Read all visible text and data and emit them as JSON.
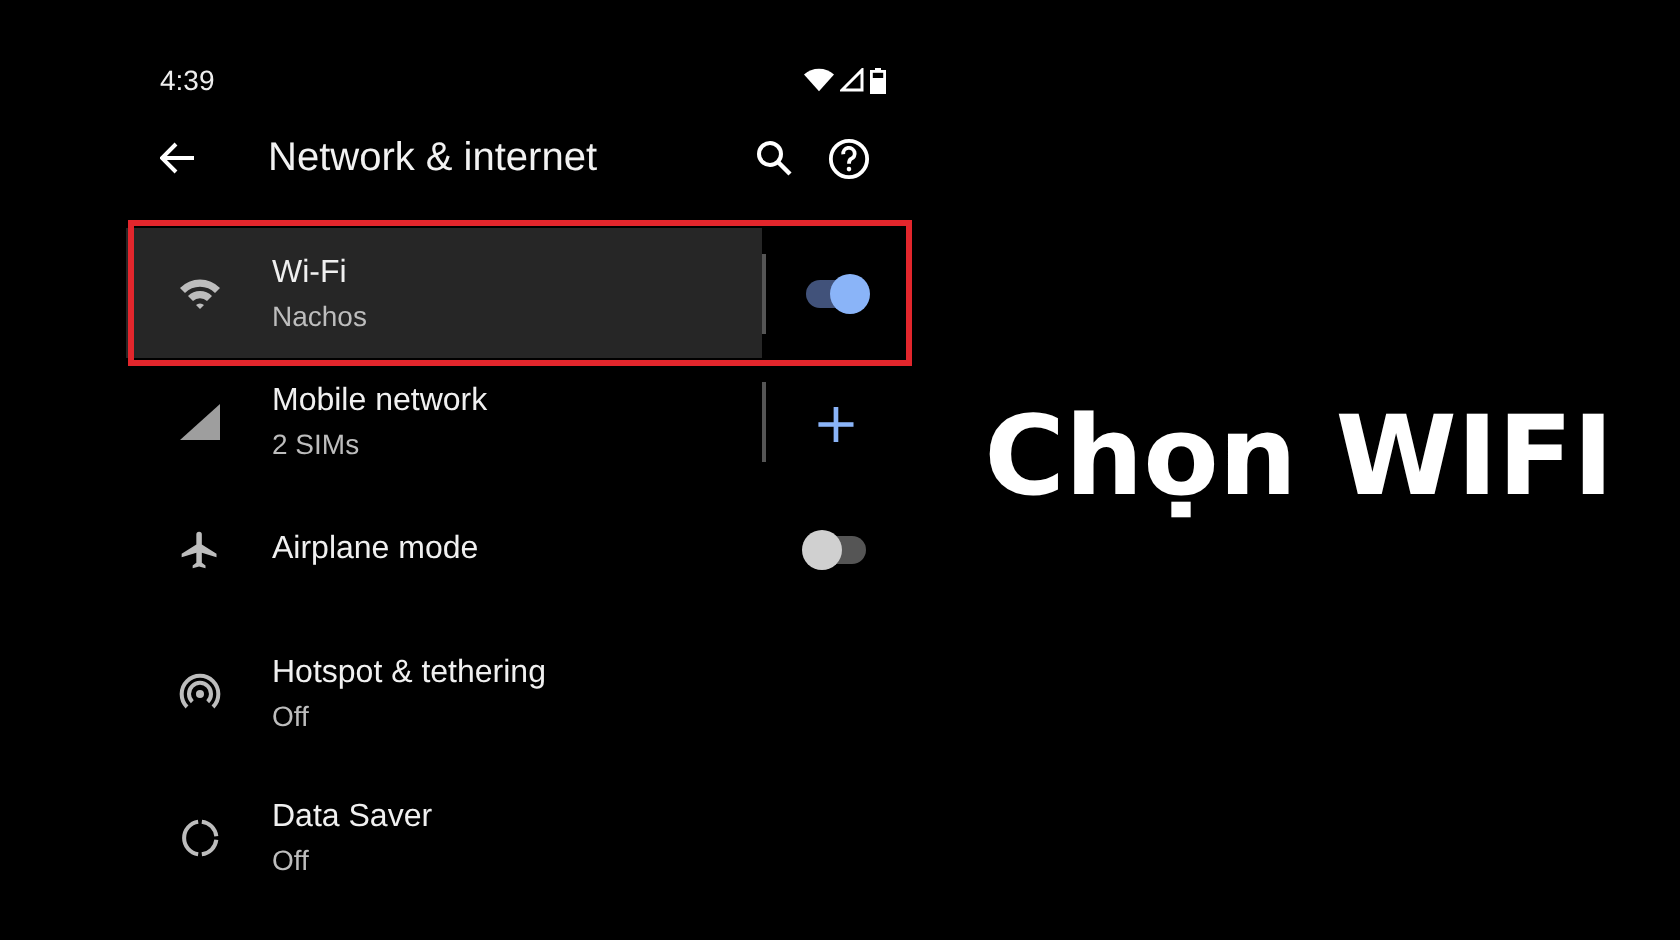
{
  "status_bar": {
    "time": "4:39"
  },
  "header": {
    "title": "Network & internet"
  },
  "items": [
    {
      "kind": "switch",
      "title": "Wi-Fi",
      "subtitle": "Nachos",
      "on": true,
      "highlighted": true
    },
    {
      "kind": "plus",
      "title": "Mobile network",
      "subtitle": "2 SIMs",
      "action": "+",
      "highlighted": false
    },
    {
      "kind": "switch",
      "title": "Airplane mode",
      "on": false,
      "highlighted": false
    },
    {
      "kind": "plain",
      "title": "Hotspot & tethering",
      "subtitle": "Off",
      "highlighted": false
    },
    {
      "kind": "plain",
      "title": "Data Saver",
      "subtitle": "Off",
      "highlighted": false
    }
  ],
  "caption": "Chọn WIFI"
}
